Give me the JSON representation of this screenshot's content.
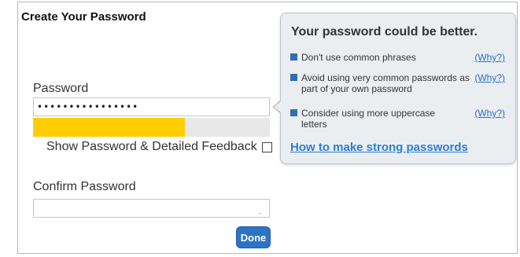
{
  "form": {
    "title": "Create Your Password",
    "password_label": "Password",
    "password_value": "••••••••••••••••",
    "strength_fraction": 0.64,
    "strength_color": "#ffcd00",
    "show_password_label": "Show Password & Detailed Feedback",
    "show_password_checked": false,
    "confirm_label": "Confirm Password",
    "confirm_value": "",
    "done_label": "Done",
    "accent": "#2b74c6"
  },
  "feedback": {
    "heading": "Your password could be better.",
    "tips": [
      {
        "text": "Don't use common phrases",
        "why": "(Why?)"
      },
      {
        "text": "Avoid using very common passwords as part of your own password",
        "why": "(Why?)"
      },
      {
        "text": "Consider using more uppercase letters",
        "why": "(Why?)"
      }
    ],
    "strong_link": "How to make strong passwords"
  }
}
